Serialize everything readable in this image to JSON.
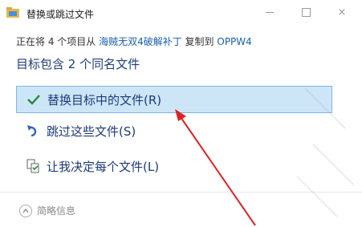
{
  "window": {
    "title": "替换或跳过文件",
    "min_label": "",
    "max_label": "",
    "close_label": "×"
  },
  "progress": {
    "prefix": "正在将 4 个项目从 ",
    "source": "海贼无双4破解补丁",
    "middle": " 复制到 ",
    "dest": "OPPW4"
  },
  "headline": "目标包含 2 个同名文件",
  "options": {
    "replace": "替换目标中的文件(R)",
    "skip": "跳过这些文件(S)",
    "decide": "让我决定每个文件(L)"
  },
  "details": {
    "label": "简略信息"
  },
  "colors": {
    "selection_bg": "#cde6f7",
    "selection_border": "#7eb4ea",
    "check": "#1e8c3a",
    "arrow": "#e02020",
    "link": "#1a5fb4"
  }
}
